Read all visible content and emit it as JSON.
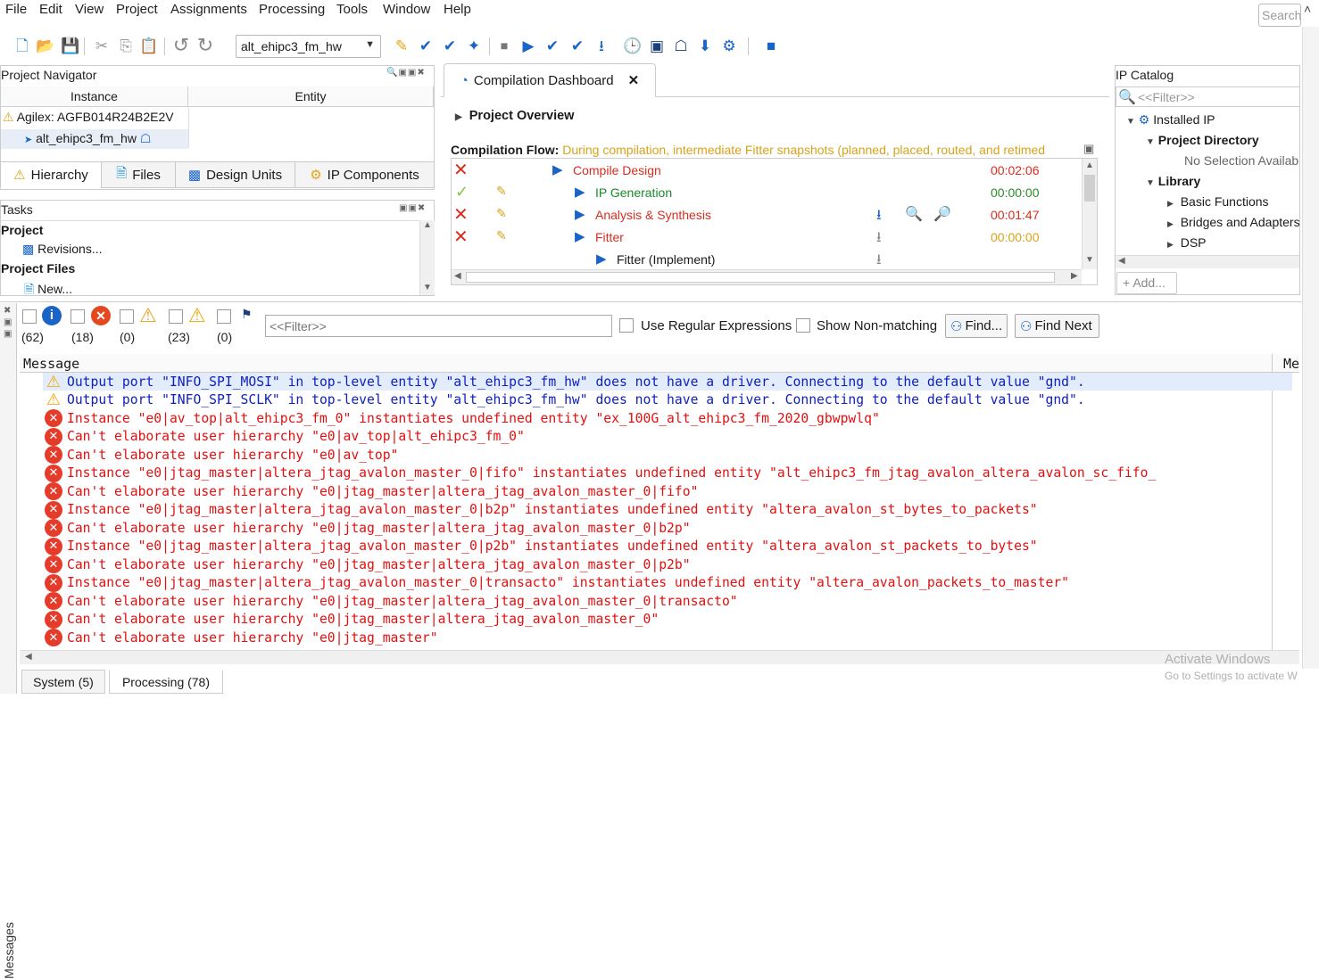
{
  "menu": [
    "File",
    "Edit",
    "View",
    "Project",
    "Assignments",
    "Processing",
    "Tools",
    "Window",
    "Help"
  ],
  "search": {
    "placeholder": "Search"
  },
  "toolbar": {
    "project_select": "alt_ehipc3_fm_hw"
  },
  "project_navigator": {
    "title": "Project Navigator",
    "columns": [
      "Instance",
      "Entity"
    ],
    "rows": [
      "Agilex: AGFB014R24B2E2V",
      "alt_ehipc3_fm_hw"
    ],
    "tabs": [
      "Hierarchy",
      "Files",
      "Design Units",
      "IP Components"
    ]
  },
  "tasks": {
    "title": "Tasks",
    "items": [
      "Project",
      "Revisions...",
      "Project Files",
      "New..."
    ]
  },
  "dashboard": {
    "tab_label": "Compilation Dashboard",
    "overview": "Project Overview",
    "flow_label": "Compilation Flow:",
    "flow_note": "During compilation, intermediate Fitter snapshots (planned, placed, routed, and retimed",
    "flow_rows": [
      {
        "name": "Compile Design",
        "time": "00:02:06",
        "status": "error"
      },
      {
        "name": "IP Generation",
        "time": "00:00:00",
        "status": "ok"
      },
      {
        "name": "Analysis & Synthesis",
        "time": "00:01:47",
        "status": "error"
      },
      {
        "name": "Fitter",
        "time": "00:00:00",
        "status": "error"
      },
      {
        "name": "Fitter (Implement)",
        "time": "",
        "status": "none"
      }
    ]
  },
  "ip_catalog": {
    "title": "IP Catalog",
    "filter_placeholder": "<<Filter>>",
    "tree": [
      "Installed IP",
      "Project Directory",
      "No Selection Available",
      "Library",
      "Basic Functions",
      "Bridges and Adapters",
      "DSP"
    ],
    "add_label": "Add..."
  },
  "messages": {
    "counts": [
      "(62)",
      "(18)",
      "(0)",
      "(23)",
      "(0)"
    ],
    "filter_placeholder": "<<Filter>>",
    "use_regex": "Use Regular Expressions",
    "show_nonmatching": "Show Non-matching",
    "find": "Find...",
    "find_next": "Find Next",
    "col_message": "Message",
    "col_more": "Me",
    "side_label": "Messages",
    "rows": [
      {
        "type": "w",
        "text": "Output port \"INFO_SPI_MOSI\" in top-level entity \"alt_ehipc3_fm_hw\" does not have a driver. Connecting to the default value \"gnd\"."
      },
      {
        "type": "w",
        "text": "Output port \"INFO_SPI_SCLK\" in top-level entity \"alt_ehipc3_fm_hw\" does not have a driver. Connecting to the default value \"gnd\"."
      },
      {
        "type": "e",
        "text": "Instance \"e0|av_top|alt_ehipc3_fm_0\" instantiates undefined entity \"ex_100G_alt_ehipc3_fm_2020_gbwpwlq\""
      },
      {
        "type": "e",
        "text": "Can't elaborate user hierarchy \"e0|av_top|alt_ehipc3_fm_0\""
      },
      {
        "type": "e",
        "text": "Can't elaborate user hierarchy \"e0|av_top\""
      },
      {
        "type": "e",
        "text": "Instance \"e0|jtag_master|altera_jtag_avalon_master_0|fifo\" instantiates undefined entity \"alt_ehipc3_fm_jtag_avalon_altera_avalon_sc_fifo_"
      },
      {
        "type": "e",
        "text": "Can't elaborate user hierarchy \"e0|jtag_master|altera_jtag_avalon_master_0|fifo\""
      },
      {
        "type": "e",
        "text": "Instance \"e0|jtag_master|altera_jtag_avalon_master_0|b2p\" instantiates undefined entity \"altera_avalon_st_bytes_to_packets\""
      },
      {
        "type": "e",
        "text": "Can't elaborate user hierarchy \"e0|jtag_master|altera_jtag_avalon_master_0|b2p\""
      },
      {
        "type": "e",
        "text": "Instance \"e0|jtag_master|altera_jtag_avalon_master_0|p2b\" instantiates undefined entity \"altera_avalon_st_packets_to_bytes\""
      },
      {
        "type": "e",
        "text": "Can't elaborate user hierarchy \"e0|jtag_master|altera_jtag_avalon_master_0|p2b\""
      },
      {
        "type": "e",
        "text": "Instance \"e0|jtag_master|altera_jtag_avalon_master_0|transacto\" instantiates undefined entity \"altera_avalon_packets_to_master\""
      },
      {
        "type": "e",
        "text": "Can't elaborate user hierarchy \"e0|jtag_master|altera_jtag_avalon_master_0|transacto\""
      },
      {
        "type": "e",
        "text": "Can't elaborate user hierarchy \"e0|jtag_master|altera_jtag_avalon_master_0\""
      },
      {
        "type": "e",
        "text": "Can't elaborate user hierarchy \"e0|jtag_master\""
      }
    ],
    "bottom_tabs": [
      "System (5)",
      "Processing (78)"
    ]
  },
  "watermark": {
    "title": "Activate Windows",
    "subtitle": "Go to Settings to activate W"
  },
  "colors": {
    "error": "#e21010",
    "warning_text": "#1020c0",
    "accent": "#1a63c7",
    "time_error": "#d92d1f",
    "time_ok": "#2a8b2a",
    "time_pending": "#d9a31a"
  }
}
